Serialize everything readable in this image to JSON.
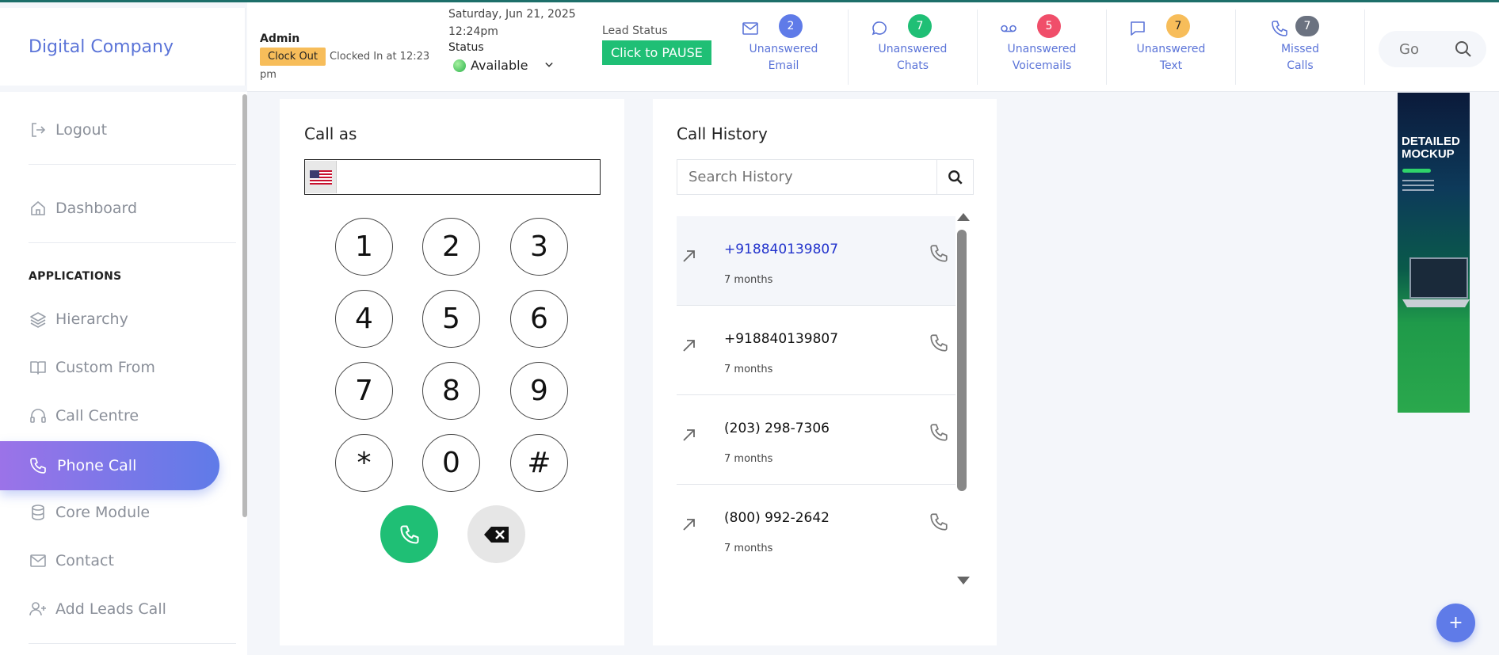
{
  "brand": {
    "name": "Digital Company"
  },
  "header": {
    "admin_label": "Admin",
    "clock_out_label": "Clock Out",
    "clocked_in_text": "Clocked In at 12:23",
    "clocked_in_suffix": "pm",
    "date": "Saturday, Jun 21, 2025",
    "time": "12:24pm",
    "status_label": "Status",
    "status_value": "Available",
    "lead_status_label": "Lead Status",
    "pause_label": "Click to PAUSE",
    "notifications": [
      {
        "line1": "Unanswered",
        "line2": "Email",
        "count": "2",
        "icon": "mail-icon",
        "badge_color": "#5f7be8"
      },
      {
        "line1": "Unanswered",
        "line2": "Chats",
        "count": "7",
        "icon": "chat-icon",
        "badge_color": "#1fbf75"
      },
      {
        "line1": "Unanswered",
        "line2": "Voicemails",
        "count": "5",
        "icon": "voicemail-icon",
        "badge_color": "#f04e6a"
      },
      {
        "line1": "Unanswered",
        "line2": "Text",
        "count": "7",
        "icon": "message-icon",
        "badge_color": "#f7bd5a"
      },
      {
        "line1": "Missed",
        "line2": "Calls",
        "count": "7",
        "icon": "phone-missed-icon",
        "badge_color": "#6b7280"
      }
    ],
    "search_placeholder": "Go"
  },
  "sidebar": {
    "logout": "Logout",
    "dashboard": "Dashboard",
    "section_heading": "APPLICATIONS",
    "items": [
      {
        "label": "Hierarchy",
        "icon": "layers-icon"
      },
      {
        "label": "Custom From",
        "icon": "book-icon"
      },
      {
        "label": "Call Centre",
        "icon": "headphones-icon"
      },
      {
        "label": "Phone Call",
        "icon": "phone-icon",
        "active": true
      },
      {
        "label": "Core Module",
        "icon": "database-icon"
      },
      {
        "label": "Contact",
        "icon": "mail-icon"
      },
      {
        "label": "Add Leads Call",
        "icon": "user-plus-icon"
      }
    ]
  },
  "dialer": {
    "title": "Call as",
    "phone_value": "",
    "keys": [
      "1",
      "2",
      "3",
      "4",
      "5",
      "6",
      "7",
      "8",
      "9",
      "*",
      "0",
      "#"
    ]
  },
  "history": {
    "title": "Call History",
    "search_placeholder": "Search History",
    "calls": [
      {
        "number": "+918840139807",
        "ago": "7 months"
      },
      {
        "number": "+918840139807",
        "ago": "7 months"
      },
      {
        "number": "(203) 298-7306",
        "ago": "7 months"
      },
      {
        "number": "(800) 992-2642",
        "ago": "7 months"
      }
    ]
  },
  "ad": {
    "title_line1": "DETAILED",
    "title_line2": "MOCKUP"
  },
  "fab": {
    "label": "+"
  },
  "colors": {
    "accent": "#5f7be8",
    "success": "#1fbf75",
    "warning": "#f7bd5a",
    "danger": "#f04e6a"
  }
}
